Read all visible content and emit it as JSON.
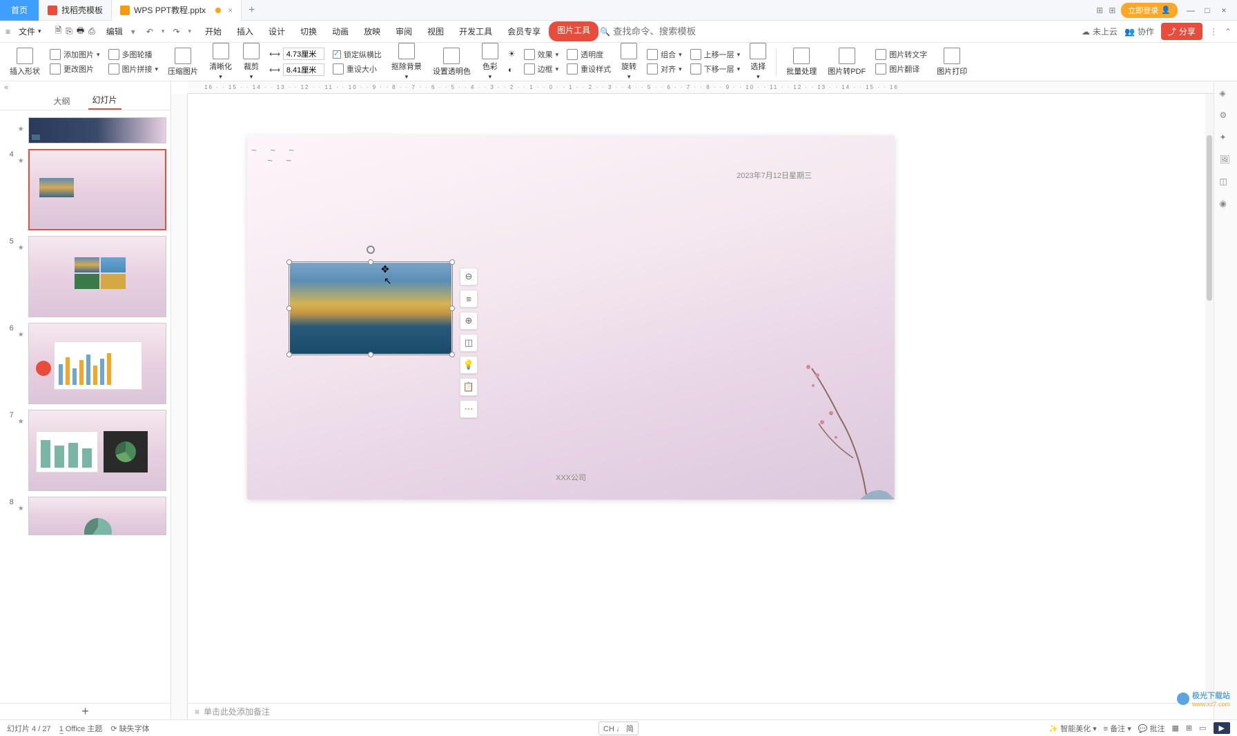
{
  "tabs": {
    "home": "首页",
    "templates": "找稻壳模板",
    "doc": "WPS PPT教程.pptx"
  },
  "titlebar": {
    "login": "立即登录"
  },
  "menubar": {
    "file": "文件",
    "edit": "编辑",
    "tabs": [
      "开始",
      "插入",
      "设计",
      "切换",
      "动画",
      "放映",
      "审阅",
      "视图",
      "开发工具",
      "会员专享",
      "图片工具"
    ],
    "active_tab": "图片工具",
    "search_placeholder": "查找命令、搜索模板",
    "not_cloud": "未上云",
    "collab": "协作",
    "share": "分享"
  },
  "ribbon": {
    "insert_shape": "插入形状",
    "add_image": "添加图片",
    "multi_carousel": "多图轮播",
    "change_image": "更改图片",
    "image_stitch": "图片拼接",
    "compress": "压缩图片",
    "sharpen": "清晰化",
    "crop": "裁剪",
    "height_label": "4.73厘米",
    "width_label": "8.41厘米",
    "lock_ratio": "锁定纵横比",
    "reset_size": "重设大小",
    "remove_bg": "抠除背景",
    "set_transparent": "设置透明色",
    "color": "色彩",
    "effect": "效果",
    "transparency": "透明度",
    "border": "边框",
    "reset_style": "重设样式",
    "rotate": "旋转",
    "group": "组合",
    "align": "对齐",
    "move_up": "上移一层",
    "move_down": "下移一层",
    "select": "选择",
    "batch": "批量处理",
    "to_pdf": "图片转PDF",
    "to_text": "图片转文字",
    "translate": "图片翻译",
    "print": "图片打印"
  },
  "sidepanel": {
    "outline": "大纲",
    "slides": "幻灯片",
    "thumb_nums": [
      "4",
      "5",
      "6",
      "7",
      "8"
    ]
  },
  "slide": {
    "date": "2023年7月12日星期三",
    "company": "XXX公司"
  },
  "notes": {
    "placeholder": "单击此处添加备注"
  },
  "status": {
    "slide_pos": "幻灯片 4 / 27",
    "theme": "Office 主题",
    "missing_font": "缺失字体",
    "ime": "CH ♩ 简",
    "beautify": "智能美化",
    "notes_btn": "备注",
    "comments": "批注"
  },
  "ruler": "16 · · 15 · · 14 · · 13 · · 12 · · 11 · · 10 · · 9 · · 8 · · 7 · · 6 · · 5 · · 4 · · 3 · · 2 · · 1 · · 0 · · 1 · · 2 · · 3 · · 4 · · 5 · · 6 · · 7 · · 8 · · 9 · · 10 · · 11 · · 12 · · 13 · · 14 · · 15 · · 16",
  "watermark": {
    "site": "极光下载站",
    "url": "www.xz7.com"
  }
}
